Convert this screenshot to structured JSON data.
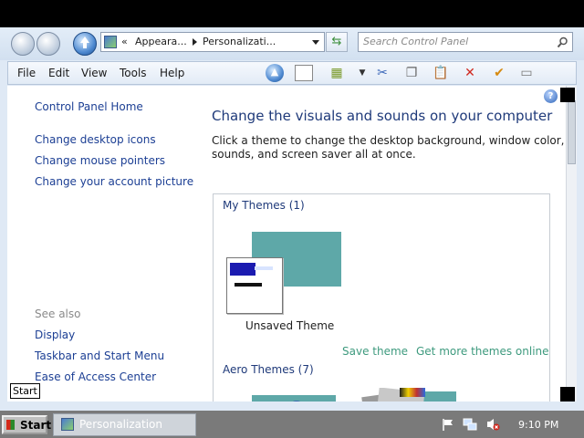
{
  "address": {
    "crumbs": [
      "«",
      "Appeara...",
      "Personalizati..."
    ],
    "search_placeholder": "Search Control Panel"
  },
  "menu": [
    "File",
    "Edit",
    "View",
    "Tools",
    "Help"
  ],
  "sidebar": {
    "home": "Control Panel Home",
    "links": [
      "Change desktop icons",
      "Change mouse pointers",
      "Change your account picture"
    ],
    "see_also_label": "See also",
    "see_also": [
      "Display",
      "Taskbar and Start Menu",
      "Ease of Access Center"
    ]
  },
  "main": {
    "title": "Change the visuals and sounds on your computer",
    "description_line1": "Click a theme to change the desktop background, window color,",
    "description_line2": "sounds, and screen saver all at once.",
    "my_themes_header": "My Themes (1)",
    "unsaved_theme_label": "Unsaved Theme",
    "save_theme_link": "Save theme",
    "get_more_link": "Get more themes online",
    "aero_themes_header": "Aero Themes (7)"
  },
  "tooltip": "Start",
  "taskbar": {
    "start_label": "Start",
    "task_label": "Personalization",
    "clock": "9:10 PM"
  },
  "colors": {
    "link": "#1c3f94",
    "title": "#1f3a7a",
    "action_link": "#3e9a7e",
    "theme_background": "#5ea8a8",
    "taskbar": "#7a7a7a"
  },
  "icons": [
    "back-arrow-icon",
    "forward-arrow-icon",
    "up-folder-icon",
    "control-panel-icon",
    "refresh-icon",
    "search-icon",
    "help-icon",
    "flag-icon",
    "network-icon",
    "volume-muted-icon"
  ]
}
